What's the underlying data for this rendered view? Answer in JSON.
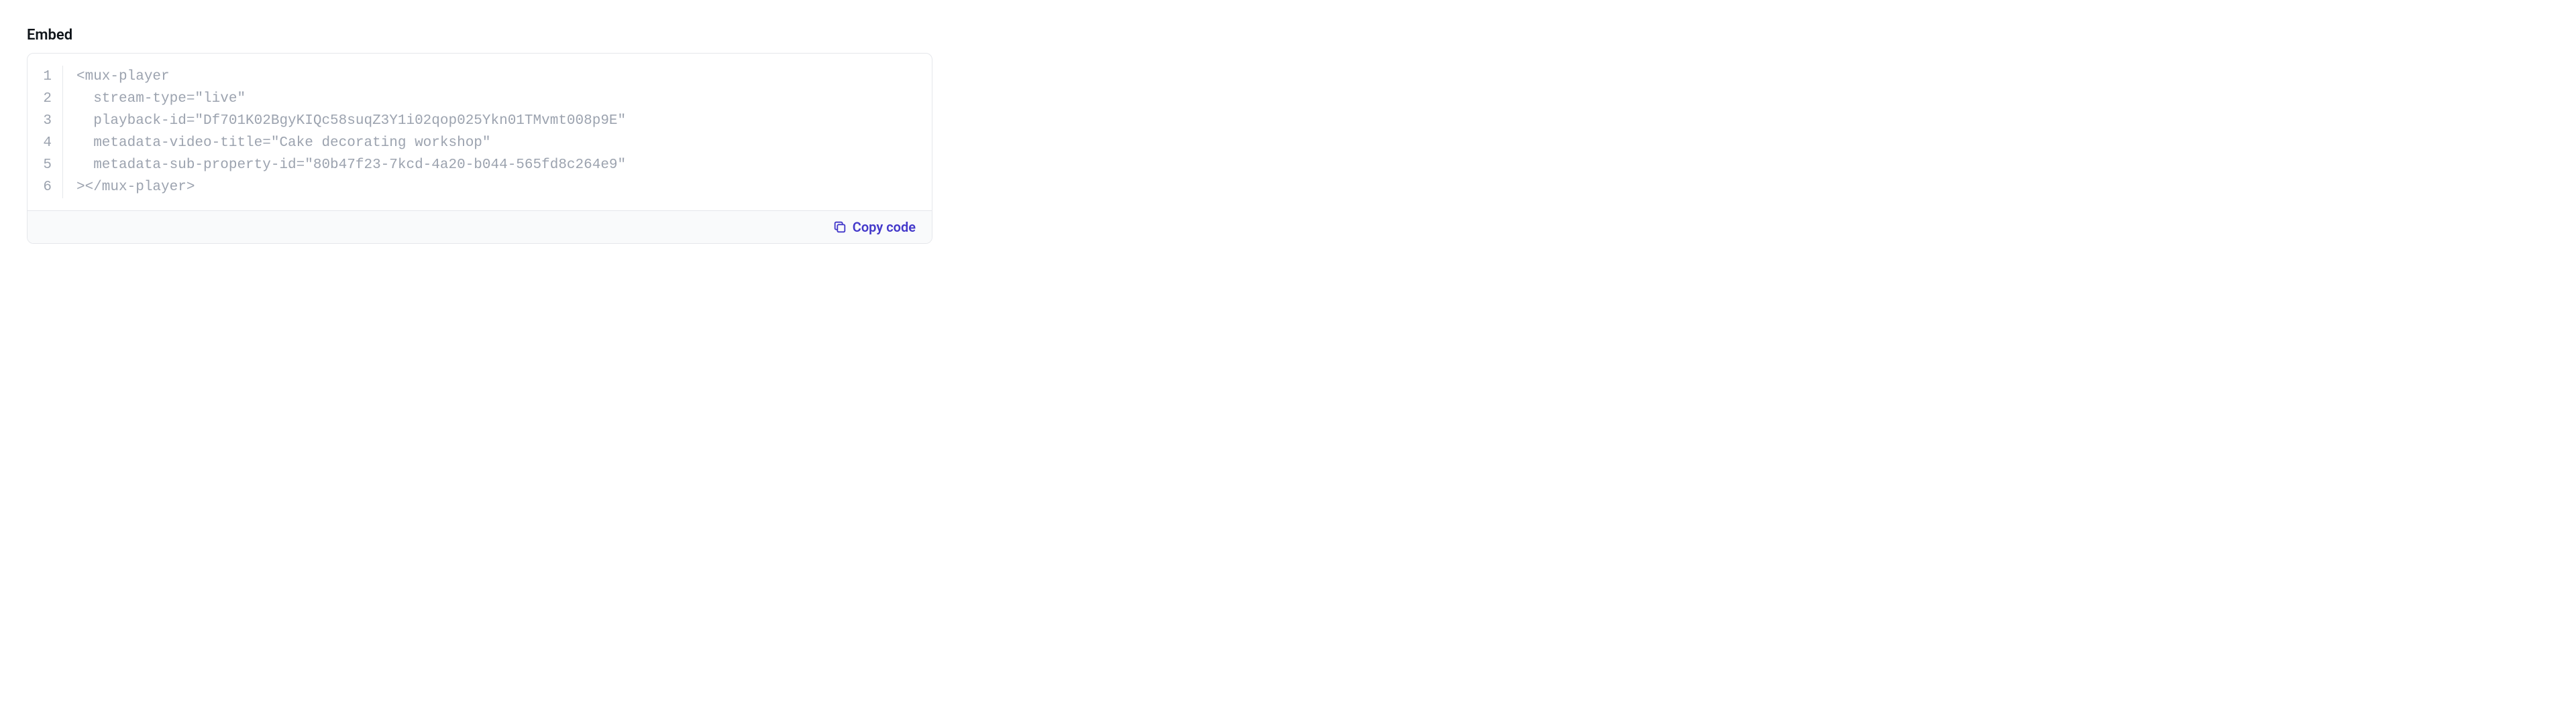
{
  "section_title": "Embed",
  "code": {
    "lines": [
      "<mux-player",
      "  stream-type=\"live\"",
      "  playback-id=\"Df701K02BgyKIQc58suqZ3Y1i02qop025Ykn01TMvmt008p9E\"",
      "  metadata-video-title=\"Cake decorating workshop\"",
      "  metadata-sub-property-id=\"80b47f23-7kcd-4a20-b044-565fd8c264e9\"",
      "></mux-player>"
    ],
    "line_numbers": [
      "1",
      "2",
      "3",
      "4",
      "5",
      "6"
    ]
  },
  "copy_button_label": "Copy code"
}
